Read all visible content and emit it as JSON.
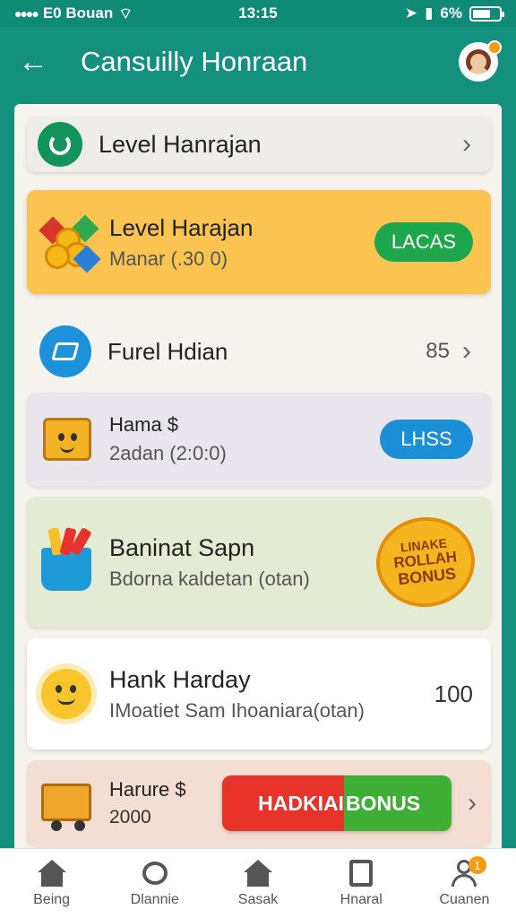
{
  "status_bar": {
    "left_text": "E0 Bouan",
    "time": "13:15",
    "battery": "6%"
  },
  "header": {
    "back_glyph": "←",
    "title": "Cansuilly Honraan"
  },
  "rows": [
    {
      "title": "Level Hanrajan",
      "chevron": "›"
    },
    {
      "title": "Level Harajan",
      "subtitle": "Manar (.30 0)",
      "button": "LACAS"
    },
    {
      "title": "Furel Hdian",
      "value": "85",
      "chevron": "›"
    },
    {
      "title": "Hama $",
      "subtitle": "2adan (2:0:0)",
      "button": "LHSS"
    },
    {
      "title": "Baninat Sapn",
      "subtitle": "Bdorna kaldetan (otan)",
      "badge": [
        "LINAKE",
        "ROLLAH",
        "BONUS"
      ]
    },
    {
      "title": "Hank Harday",
      "subtitle": "IMoatiet Sam Ihoaniara(otan)",
      "value": "100"
    },
    {
      "title": "Harure $",
      "subtitle": "2000",
      "button_left": "HADKIAI",
      "button_right": "BONUS",
      "chevron": "›"
    }
  ],
  "nav": [
    {
      "label": "Being",
      "icon": "home-icon"
    },
    {
      "label": "Dlannie",
      "icon": "disc-icon"
    },
    {
      "label": "Sasak",
      "icon": "store-icon"
    },
    {
      "label": "Hnaral",
      "icon": "document-icon"
    },
    {
      "label": "Cuanen",
      "icon": "user-icon",
      "badge": "1"
    }
  ],
  "colors": {
    "header": "#14917e",
    "accent_green": "#1ea64d",
    "accent_blue": "#1a8fd6",
    "highlight_row": "#fbc350"
  }
}
